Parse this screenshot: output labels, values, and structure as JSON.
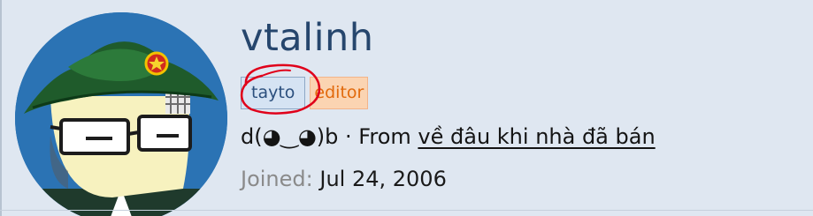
{
  "profile": {
    "username": "vtalinh",
    "badges": [
      "tayto",
      "editor"
    ],
    "status_text": "d(◕‿◕)b",
    "separator": "·",
    "from_prefix": "From",
    "location": "về đâu khi nhà đã bán",
    "joined_label": "Joined:",
    "joined_date": "Jul 24, 2006"
  },
  "colors": {
    "username": "#26466d",
    "badge_tayto_bg": "#d5e3f3",
    "badge_editor_text": "#e26a0c",
    "badge_editor_bg": "#fbd4b2",
    "annotation": "#e0001a"
  }
}
